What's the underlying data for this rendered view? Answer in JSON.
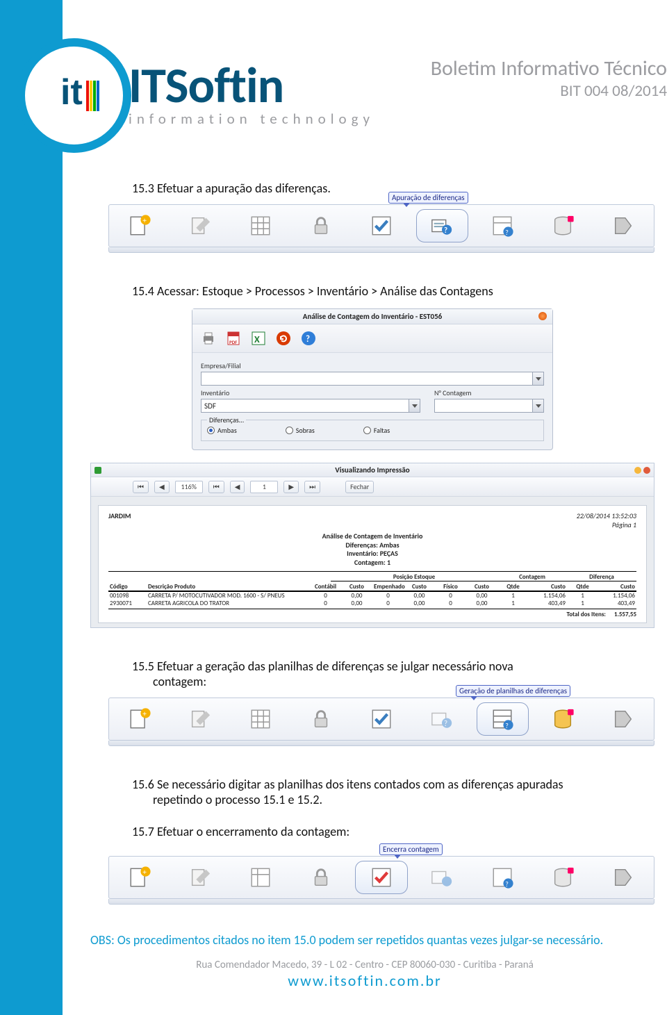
{
  "header": {
    "title": "Boletim Informativo Técnico",
    "subtitle": "BIT 004 08/2014"
  },
  "brand": {
    "name": "ITSoftin",
    "tagline": "information technology"
  },
  "sections": {
    "s153": "15.3   Efetuar a apuração das diferenças.",
    "s154": "15.4   Acessar: Estoque > Processos > Inventário > Análise das Contagens",
    "s155": "15.5   Efetuar a geração das planilhas de diferenças se julgar necessário nova contagem:",
    "s156": "15.6   Se necessário digitar as planilhas dos itens contados com as diferenças apuradas repetindo o processo 15.1 e 15.2.",
    "s157": "15.7   Efetuar o encerramento da contagem:"
  },
  "callouts": {
    "c1": "Apuração de diferenças",
    "c2": "Geração de planilhas de diferenças",
    "c3": "Encerra contagem"
  },
  "form": {
    "title": "Análise de Contagem do Inventário - EST056",
    "labels": {
      "empresa": "Empresa/Filial",
      "inventario": "Inventário",
      "ncontagem": "N° Contagem",
      "diferencas": "Diferenças..."
    },
    "inventario_value": "SDF",
    "radios": {
      "ambas": "Ambas",
      "sobras": "Sobras",
      "faltas": "Faltas"
    }
  },
  "preview": {
    "window_title": "Visualizando Impressão",
    "zoom": "116%",
    "page_no": "1",
    "close": "Fechar",
    "company": "JARDIM",
    "datetime": "22/08/2014 13:52:03",
    "page_label": "Página 1",
    "title1": "Análise de Contagem de Inventário",
    "title2": "Diferenças: Ambas",
    "title3": "Inventário: PEÇAS",
    "title4": "Contagem: 1",
    "group1": "Posição Estoque",
    "group2": "Contagem",
    "group3": "Diferença",
    "cols": [
      "Código",
      "Descrição Produto",
      "Contábil",
      "Custo",
      "Empenhado",
      "Custo",
      "Físico",
      "Custo",
      "Qtde",
      "Custo",
      "Qtde",
      "Custo"
    ],
    "rows": [
      {
        "c": [
          "001098",
          "CARRETA P/ MOTOCUTIVADOR MOD. 1600 - S/ PNEUS",
          "0",
          "0,00",
          "0",
          "0,00",
          "0",
          "0,00",
          "1",
          "1.154,06",
          "1",
          "1.154,06"
        ]
      },
      {
        "c": [
          "2930071",
          "CARRETA AGRICOLA DO TRATOR",
          "0",
          "0,00",
          "0",
          "0,00",
          "0",
          "0,00",
          "1",
          "403,49",
          "1",
          "403,49"
        ]
      }
    ],
    "total_label": "Total dos Itens:",
    "total_value": "1.557,55"
  },
  "obs": "OBS: Os procedimentos citados no item 15.0 podem ser repetidos quantas vezes julgar-se necessário.",
  "footer": {
    "address": "Rua Comendador Macedo, 39 - L 02 - Centro - CEP 80060-030 - Curitiba - Paraná",
    "url": "www.itsoftin.com.br"
  },
  "chart_data": {
    "type": "table",
    "title": "Análise de Contagem de Inventário — Diferenças: Ambas — Inventário: PEÇAS — Contagem: 1",
    "columns": [
      "Código",
      "Descrição Produto",
      "Contábil",
      "Custo Contábil",
      "Empenhado",
      "Custo Empenhado",
      "Físico",
      "Custo Físico",
      "Contagem Qtde",
      "Contagem Custo",
      "Diferença Qtde",
      "Diferença Custo"
    ],
    "rows": [
      [
        "001098",
        "CARRETA P/ MOTOCUTIVADOR MOD. 1600 - S/ PNEUS",
        0,
        0.0,
        0,
        0.0,
        0,
        0.0,
        1,
        1154.06,
        1,
        1154.06
      ],
      [
        "2930071",
        "CARRETA AGRICOLA DO TRATOR",
        0,
        0.0,
        0,
        0.0,
        0,
        0.0,
        1,
        403.49,
        1,
        403.49
      ]
    ],
    "totals": {
      "label": "Total dos Itens",
      "value": 1557.55
    }
  }
}
